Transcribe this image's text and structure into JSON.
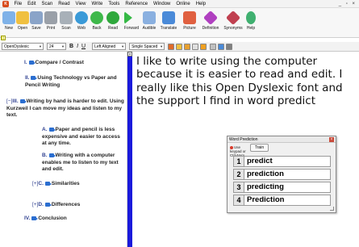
{
  "menubar": {
    "items": [
      "File",
      "Edit",
      "Scan",
      "Read",
      "View",
      "Write",
      "Tools",
      "Reference",
      "Window",
      "Online",
      "Help"
    ],
    "window_controls": "_ ▫ ×"
  },
  "toolbar": {
    "buttons": [
      {
        "label": "New",
        "icon": "new-document-icon",
        "color": "#7fb2e8"
      },
      {
        "label": "Open",
        "icon": "open-folder-icon",
        "color": "#f0c040"
      },
      {
        "label": "Save",
        "icon": "save-icon",
        "color": "#8aa4c8"
      },
      {
        "label": "Print",
        "icon": "printer-icon",
        "color": "#9aa0a8"
      },
      {
        "label": "Scan",
        "icon": "scanner-icon",
        "color": "#a8b0b8"
      },
      {
        "label": "Web",
        "icon": "globe-icon",
        "color": "#3a9ad8"
      },
      {
        "label": "Back",
        "icon": "back-arrow-icon",
        "color": "#3eb84a"
      },
      {
        "label": "Read",
        "icon": "read-icon",
        "color": "#2fa83c"
      },
      {
        "label": "Forward",
        "icon": "forward-arrow-icon",
        "color": "#35b845"
      },
      {
        "label": "Audible",
        "icon": "speaker-icon",
        "color": "#8ab0e0"
      },
      {
        "label": "Translate",
        "icon": "translate-icon",
        "color": "#4a8ad8"
      },
      {
        "label": "Picture",
        "icon": "picture-icon",
        "color": "#e06040"
      },
      {
        "label": "Definition",
        "icon": "definition-icon",
        "color": "#b040c0"
      },
      {
        "label": "Synonyms",
        "icon": "synonyms-icon",
        "color": "#c04050"
      },
      {
        "label": "Help",
        "icon": "help-icon",
        "color": "#40b070"
      }
    ]
  },
  "formatbar": {
    "font": "OpenDyslexic",
    "size": "24",
    "bold": "B",
    "italic": "I",
    "underline": "U",
    "alignment": "Left Aligned",
    "spacing": "Single Spaced"
  },
  "outline": {
    "items": [
      {
        "num": "I.",
        "text": "Compare / Contrast"
      },
      {
        "num": "II.",
        "text": "Using Technology vs Paper and Pencil Writing"
      },
      {
        "toggle": "[−]",
        "num": "III.",
        "text": "Writing by hand is harder to edit. Using Kurzweil I can move my ideas and listen to my text."
      },
      {
        "num": "A.",
        "text": "Paper and pencil is less expensive and easier to access at any time."
      },
      {
        "num": "B.",
        "text": "Writing with a computer enables me to listen to my text and edit."
      },
      {
        "toggle": "[+]",
        "num": "C.",
        "text": "Similarities"
      },
      {
        "toggle": "[+]",
        "num": "D.",
        "text": "Differences"
      },
      {
        "num": "IV.",
        "text": "Conclusion"
      }
    ]
  },
  "document": {
    "text": "I like to write using the computer because it is easier to read and edit. I really like this Open Dyslexic font and the support I find in word predict"
  },
  "word_prediction": {
    "title": "Word Prediction",
    "option_label": "Use keypad or Ctrl-Num",
    "train_label": "Train",
    "predictions": [
      {
        "num": "1",
        "word": "predict"
      },
      {
        "num": "2",
        "word": "prediction"
      },
      {
        "num": "3",
        "word": "predicting"
      },
      {
        "num": "4",
        "word": "Prediction"
      }
    ]
  }
}
